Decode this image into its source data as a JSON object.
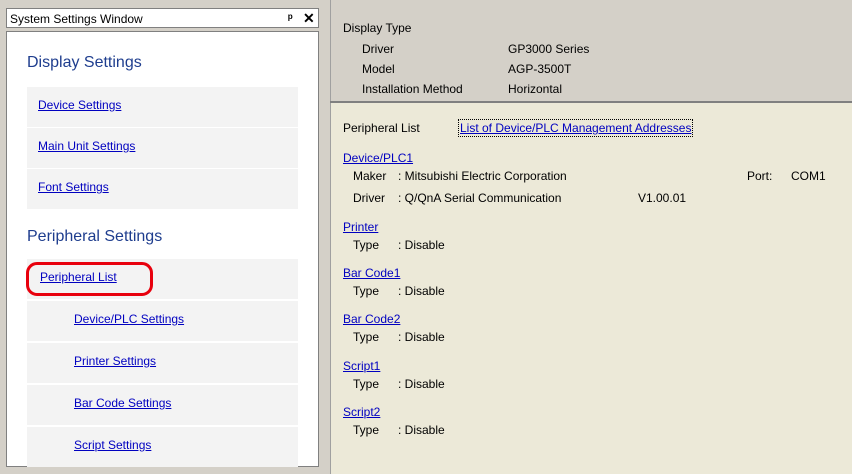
{
  "left_panel": {
    "title": "System Settings Window",
    "pin_glyph": "ᵖ",
    "close_glyph": "✕",
    "display_heading": "Display Settings",
    "display_items": [
      "Device Settings",
      "Main Unit Settings",
      "Font Settings"
    ],
    "peripheral_heading": "Peripheral Settings",
    "peripheral_list": "Peripheral List",
    "peripheral_items": [
      "Device/PLC Settings",
      "Printer Settings",
      "Bar Code Settings",
      "Script Settings"
    ],
    "highlight_color": "#e8000d"
  },
  "display_type": {
    "heading": "Display Type",
    "rows": [
      {
        "label": "Driver",
        "value": "GP3000 Series"
      },
      {
        "label": "Model",
        "value": "AGP-3500T"
      },
      {
        "label": "Installation Method",
        "value": "Horizontal"
      }
    ]
  },
  "peripheral": {
    "heading": "Peripheral List",
    "management_link": "List of Device/PLC Management Addresses",
    "device": {
      "title": "Device/PLC1",
      "maker_label": "Maker",
      "maker_value": ": Mitsubishi Electric Corporation",
      "port_label": "Port:",
      "port_value": "COM1",
      "driver_label": "Driver",
      "driver_value": ": Q/QnA Serial Communication",
      "driver_version": "V1.00.01"
    },
    "entries": [
      {
        "title": "Printer",
        "type_label": "Type",
        "type_value": ": Disable"
      },
      {
        "title": "Bar Code1",
        "type_label": "Type",
        "type_value": ": Disable"
      },
      {
        "title": "Bar Code2",
        "type_label": "Type",
        "type_value": ": Disable"
      },
      {
        "title": "Script1",
        "type_label": "Type",
        "type_value": ": Disable"
      },
      {
        "title": "Script2",
        "type_label": "Type",
        "type_value": ": Disable"
      }
    ]
  }
}
